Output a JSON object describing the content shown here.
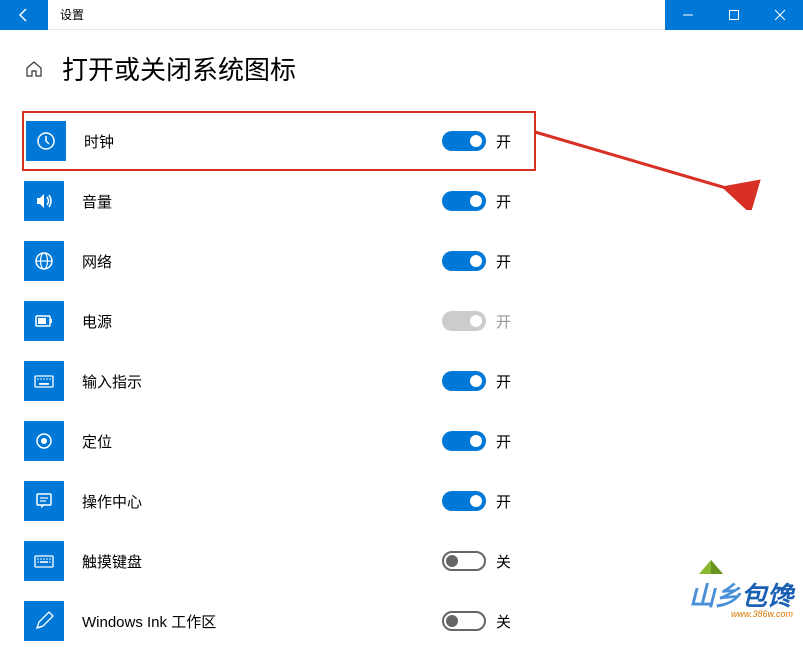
{
  "titlebar": {
    "title": "设置"
  },
  "page": {
    "title": "打开或关闭系统图标"
  },
  "toggle_labels": {
    "on": "开",
    "off": "关"
  },
  "settings": [
    {
      "icon": "clock",
      "label": "时钟",
      "state": "on",
      "highlighted": true
    },
    {
      "icon": "volume",
      "label": "音量",
      "state": "on"
    },
    {
      "icon": "network",
      "label": "网络",
      "state": "on"
    },
    {
      "icon": "power",
      "label": "电源",
      "state": "disabled"
    },
    {
      "icon": "ime",
      "label": "输入指示",
      "state": "on"
    },
    {
      "icon": "location",
      "label": "定位",
      "state": "on"
    },
    {
      "icon": "action",
      "label": "操作中心",
      "state": "on"
    },
    {
      "icon": "touch-kb",
      "label": "触摸键盘",
      "state": "off"
    },
    {
      "icon": "ink",
      "label": "Windows Ink 工作区",
      "state": "off"
    }
  ],
  "watermark": {
    "text1": "山乡",
    "text2": "包馋",
    "url": "www.386w.com"
  },
  "colors": {
    "accent": "#0078d7",
    "highlight": "#d93025"
  }
}
